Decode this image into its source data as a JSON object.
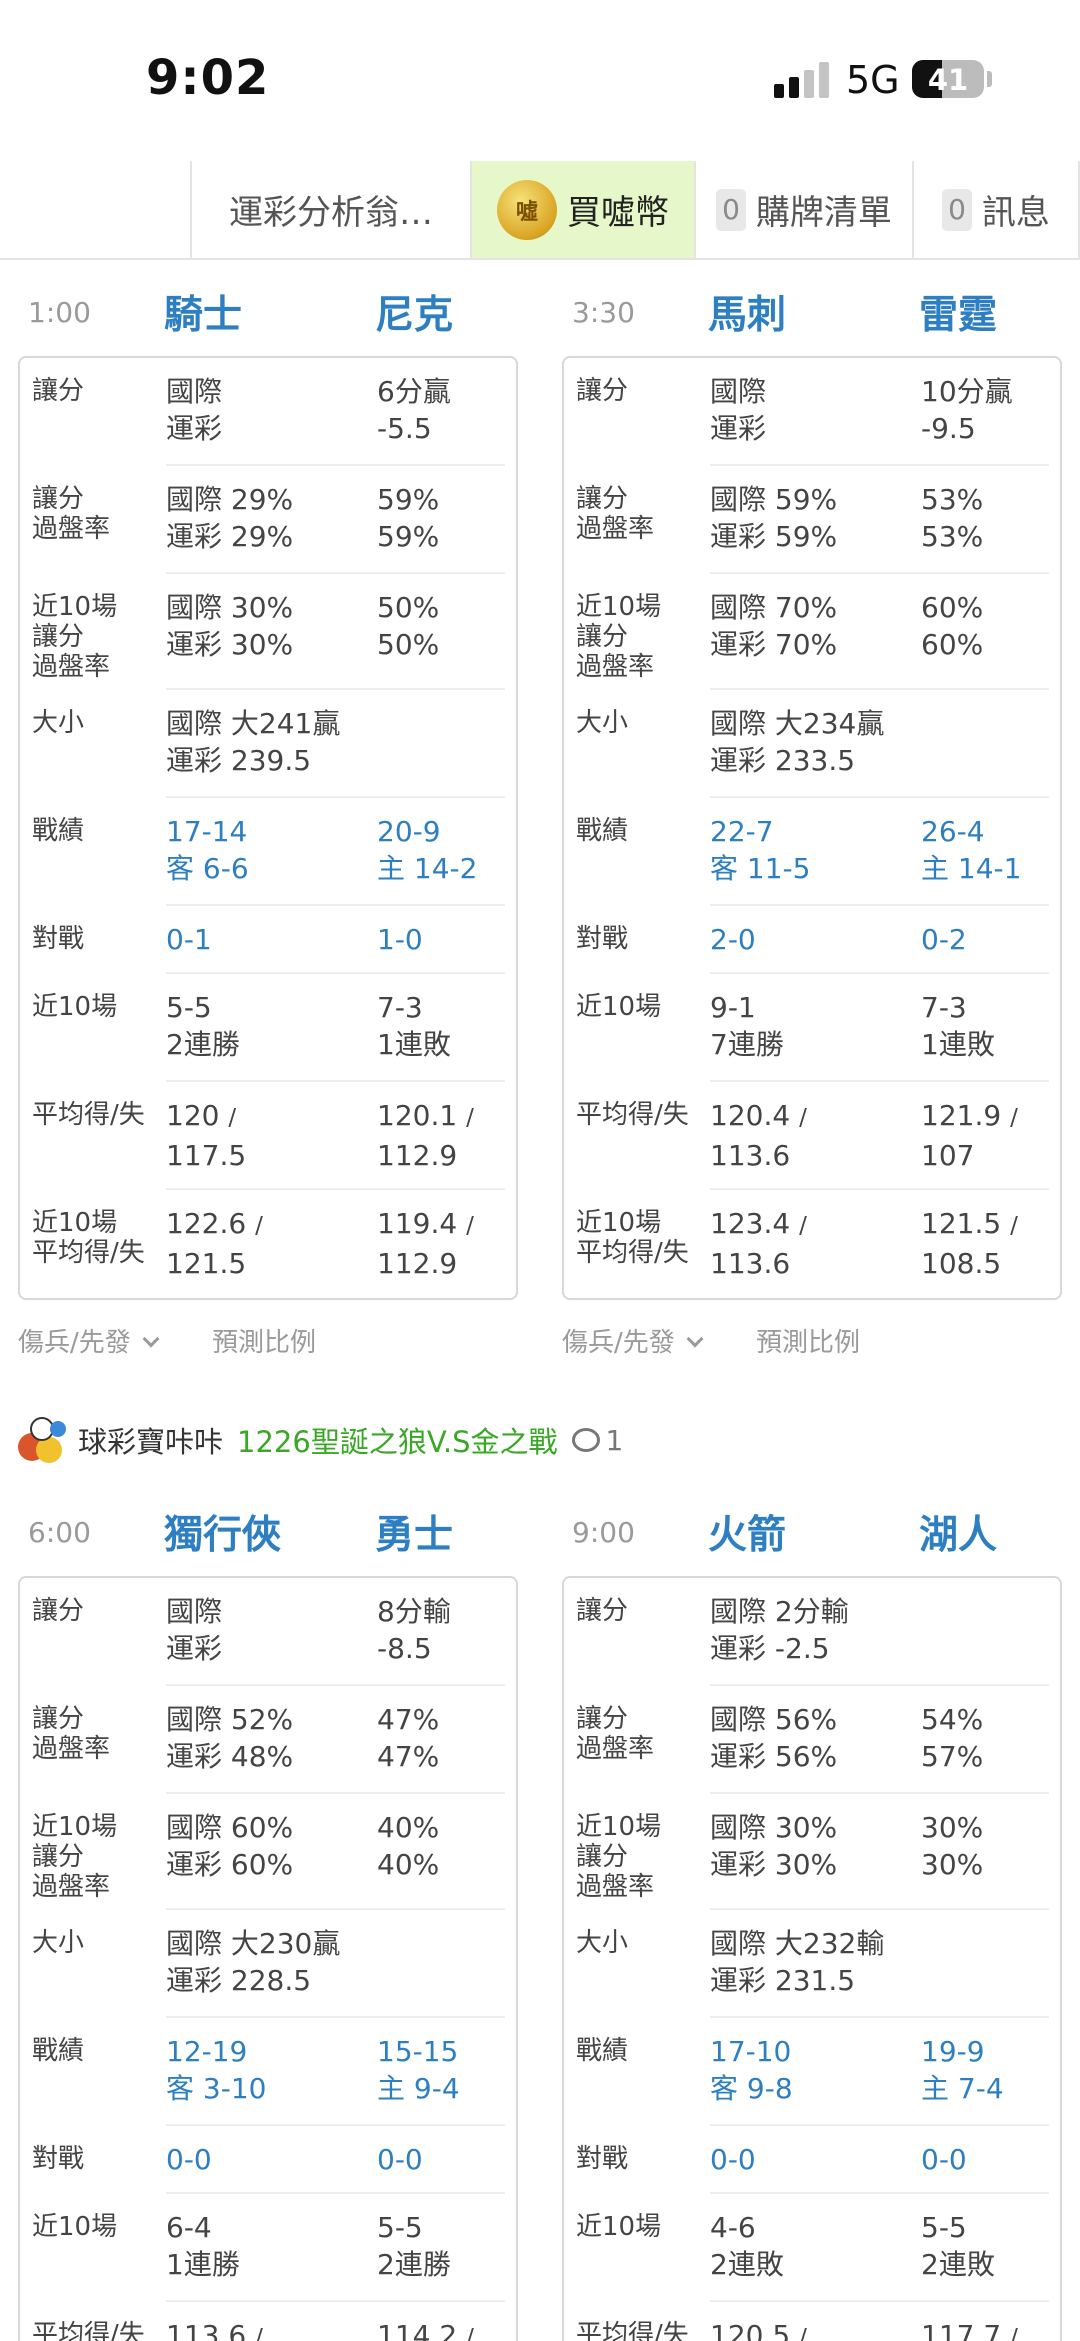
{
  "status_bar": {
    "time": "9:02",
    "network": "5G",
    "battery": "41",
    "battery_level": 0.41
  },
  "tabs": [
    {
      "label": "運彩分析翁…"
    },
    {
      "label": "買噓幣",
      "icon": "coin-icon",
      "coin_glyph": "噓"
    },
    {
      "label": "購牌清單",
      "count": "0"
    },
    {
      "label": "訊息",
      "count": "0"
    }
  ],
  "row_labels": {
    "spread": "讓分",
    "cover_1": "讓分",
    "cover_2": "過盤率",
    "l10_1": "近10場",
    "l10_2": "讓分",
    "l10_3": "過盤率",
    "total": "大小",
    "record": "戰績",
    "h2h": "對戰",
    "last10": "近10場",
    "avg": "平均得/失",
    "l10avg_1": "近10場",
    "l10avg_2": "平均得/失"
  },
  "footer": {
    "injuries": "傷兵/先發",
    "prediction": "預測比例"
  },
  "matches": [
    {
      "time": "1:00",
      "away": "騎士",
      "home": "尼克",
      "spread": {
        "c1a": "國際",
        "c1b": "運彩",
        "c2a": "6分贏",
        "c2b": "-5.5"
      },
      "cover": {
        "c1a": "國際 29%",
        "c1b": "運彩 29%",
        "c2a": "59%",
        "c2b": "59%"
      },
      "l10cover": {
        "c1a": "國際 30%",
        "c1b": "運彩 30%",
        "c2a": "50%",
        "c2b": "50%"
      },
      "total": {
        "c1a": "國際 大241贏",
        "c1b": "運彩 239.5"
      },
      "record": {
        "c1a": "17-14",
        "c1b": "客 6-6",
        "c2a": "20-9",
        "c2b": "主 14-2"
      },
      "h2h": {
        "c1": "0-1",
        "c2": "1-0"
      },
      "last10": {
        "c1a": "5-5",
        "c1b": "2連勝",
        "c2a": "7-3",
        "c2b": "1連敗"
      },
      "avg": {
        "c1a": "120",
        "c1b": "117.5",
        "c2a": "120.1",
        "c2b": "112.9"
      },
      "l10avg": {
        "c1a": "122.6",
        "c1b": "121.5",
        "c2a": "119.4",
        "c2b": "112.9"
      }
    },
    {
      "time": "3:30",
      "away": "馬刺",
      "home": "雷霆",
      "spread": {
        "c1a": "國際",
        "c1b": "運彩",
        "c2a": "10分贏",
        "c2b": "-9.5"
      },
      "cover": {
        "c1a": "國際 59%",
        "c1b": "運彩 59%",
        "c2a": "53%",
        "c2b": "53%"
      },
      "l10cover": {
        "c1a": "國際 70%",
        "c1b": "運彩 70%",
        "c2a": "60%",
        "c2b": "60%"
      },
      "total": {
        "c1a": "國際 大234贏",
        "c1b": "運彩 233.5"
      },
      "record": {
        "c1a": "22-7",
        "c1b": "客 11-5",
        "c2a": "26-4",
        "c2b": "主 14-1"
      },
      "h2h": {
        "c1": "2-0",
        "c2": "0-2"
      },
      "last10": {
        "c1a": "9-1",
        "c1b": "7連勝",
        "c2a": "7-3",
        "c2b": "1連敗"
      },
      "avg": {
        "c1a": "120.4",
        "c1b": "113.6",
        "c2a": "121.9",
        "c2b": "107"
      },
      "l10avg": {
        "c1a": "123.4",
        "c1b": "113.6",
        "c2a": "121.5",
        "c2b": "108.5"
      }
    },
    {
      "time": "6:00",
      "away": "獨行俠",
      "home": "勇士",
      "spread": {
        "c1a": "國際",
        "c1b": "運彩",
        "c2a": "8分輸",
        "c2b": "-8.5"
      },
      "cover": {
        "c1a": "國際 52%",
        "c1b": "運彩 48%",
        "c2a": "47%",
        "c2b": "47%"
      },
      "l10cover": {
        "c1a": "國際 60%",
        "c1b": "運彩 60%",
        "c2a": "40%",
        "c2b": "40%"
      },
      "total": {
        "c1a": "國際 大230贏",
        "c1b": "運彩 228.5"
      },
      "record": {
        "c1a": "12-19",
        "c1b": "客 3-10",
        "c2a": "15-15",
        "c2b": "主 9-4"
      },
      "h2h": {
        "c1": "0-0",
        "c2": "0-0"
      },
      "last10": {
        "c1a": "6-4",
        "c1b": "1連勝",
        "c2a": "5-5",
        "c2b": "2連勝"
      },
      "avg": {
        "c1a": "113.6",
        "c2a": "114.2"
      }
    },
    {
      "time": "9:00",
      "away": "火箭",
      "home": "湖人",
      "spread": {
        "c1a": "國際 2分輸",
        "c1b": "運彩 -2.5",
        "c2a": "",
        "c2b": ""
      },
      "cover": {
        "c1a": "國際 56%",
        "c1b": "運彩 56%",
        "c2a": "54%",
        "c2b": "57%"
      },
      "l10cover": {
        "c1a": "國際 30%",
        "c1b": "運彩 30%",
        "c2a": "30%",
        "c2b": "30%"
      },
      "total": {
        "c1a": "國際 大232輸",
        "c1b": "運彩 231.5"
      },
      "record": {
        "c1a": "17-10",
        "c1b": "客 9-8",
        "c2a": "19-9",
        "c2b": "主 7-4"
      },
      "h2h": {
        "c1": "0-0",
        "c2": "0-0"
      },
      "last10": {
        "c1a": "4-6",
        "c1b": "2連敗",
        "c2a": "5-5",
        "c2b": "2連敗"
      },
      "avg": {
        "c1a": "120.5",
        "c2a": "117.7"
      }
    }
  ],
  "post": {
    "author": "球彩寶咔咔",
    "title": "1226聖誕之狼V.S金之戰",
    "comment_count": "1"
  },
  "colors": {
    "team_blue": "#2d7fc1",
    "post_green": "#3aa826",
    "tab_active_bg": "#e6f8c9"
  }
}
